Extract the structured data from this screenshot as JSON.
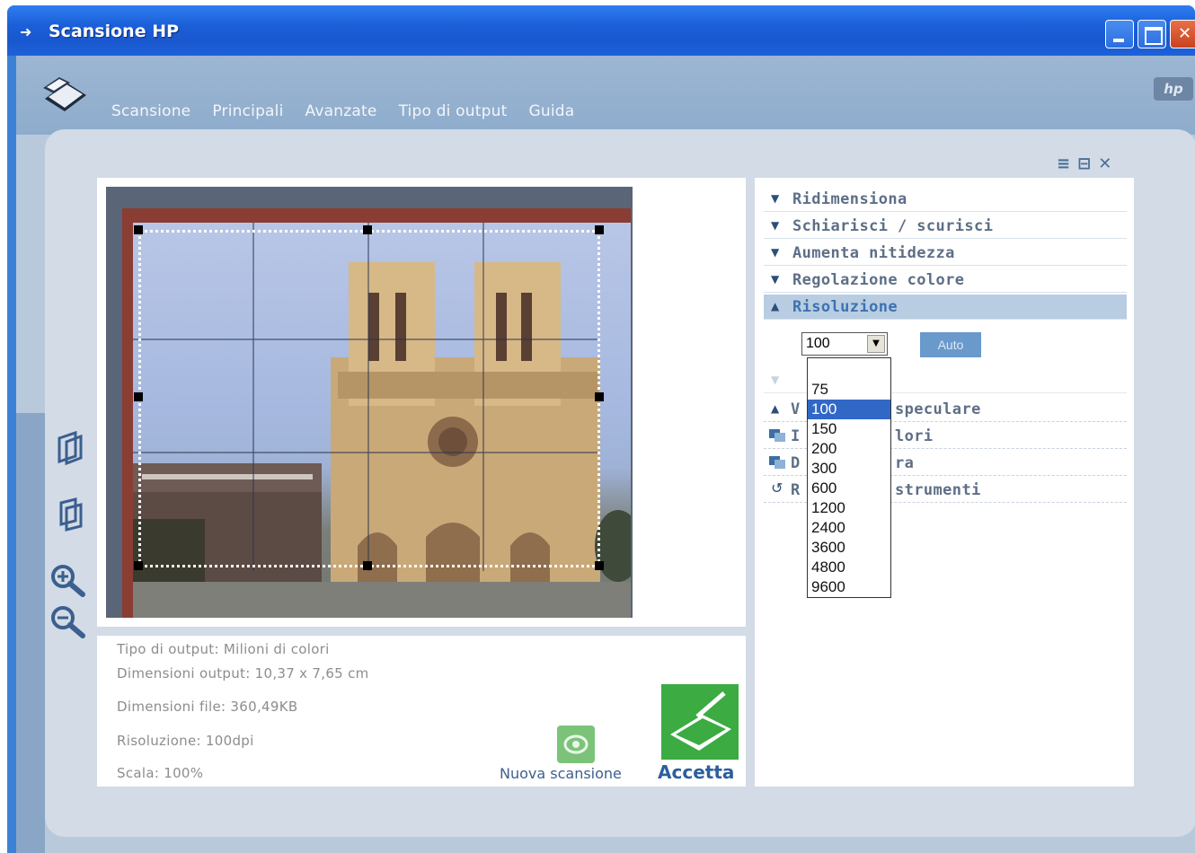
{
  "window": {
    "title": "Scansione HP"
  },
  "menu": [
    "Scansione",
    "Principali",
    "Avanzate",
    "Tipo di output",
    "Guida"
  ],
  "settings": {
    "rows": [
      {
        "label": "Ridimensiona"
      },
      {
        "label": "Schiarisci / scurisci"
      },
      {
        "label": "Aumenta nitidezza"
      },
      {
        "label": "Regolazione colore"
      },
      {
        "label": "Risoluzione"
      }
    ],
    "lower_rows": [
      {
        "label": "V"
      },
      {
        "label": "speculare"
      },
      {
        "label": "I"
      },
      {
        "label": "lori"
      },
      {
        "label": "D"
      },
      {
        "label": "ra"
      },
      {
        "label": "R"
      },
      {
        "label": "strumenti"
      }
    ],
    "resolution": {
      "selected": "100",
      "auto_label": "Auto",
      "options": [
        "75",
        "100",
        "150",
        "200",
        "300",
        "600",
        "1200",
        "2400",
        "3600",
        "4800",
        "9600"
      ]
    }
  },
  "info": {
    "output_type": "Tipo di output: Milioni di colori",
    "output_size": "Dimensioni output: 10,37 x 7,65 cm",
    "file_size": "Dimensioni file: 360,49KB",
    "resolution": "Risoluzione:  100dpi",
    "scale": "Scala: 100%"
  },
  "actions": {
    "new_scan": "Nuova scansione",
    "accept": "Accetta"
  },
  "colors": {
    "title_bar": "#1b5fd8",
    "accent": "#3bab42",
    "selection": "#3168c6"
  }
}
